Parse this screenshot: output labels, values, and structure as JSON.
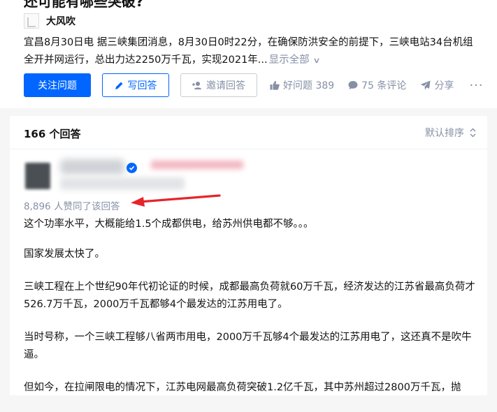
{
  "question": {
    "title": "还可能有哪些突破?",
    "author_name": "大风吹",
    "description_lines": [
      "宜昌8月30日电 据三峡集团消息，8月30日0时22分，在确保防洪安全的前提下，三峡电站34台机组",
      "全开并网运行，总出力达2250万千瓦，实现2021年..."
    ],
    "show_all": "显示全部",
    "actions": {
      "follow": "关注问题",
      "write": "写回答",
      "invite": "邀请回答",
      "like": "好问题 389",
      "comments": "75 条评论",
      "share": "分享",
      "more": "···"
    }
  },
  "answers": {
    "count_label": "166 个回答",
    "sort_label": "默认排序",
    "answer": {
      "vote_note": "8,896 人赞同了该回答",
      "paragraphs": [
        "这个功率水平，大概能给1.5个成都供电，给苏州供电都不够。。。",
        "国家发展太快了。",
        "三峡工程在上个世纪90年代初论证的时候，成都最高负荷就60万千瓦，经济发达的江苏省最高负荷才526.7万千瓦，2000万千瓦都够4个最发达的江苏用电了。",
        "当时号称，一个三峡工程够八省两市用电，2000万千瓦够4个最发达的江苏用电了，这还真不是吹牛逼。",
        "但如今，在拉闸限电的情况下，江苏电网最高负荷突破1.2亿千瓦，其中苏州超过2800万千瓦，抛"
      ]
    }
  },
  "colors": {
    "primary": "#0066ff",
    "muted": "#8590a6",
    "annotation_arrow": "#e5252a"
  }
}
